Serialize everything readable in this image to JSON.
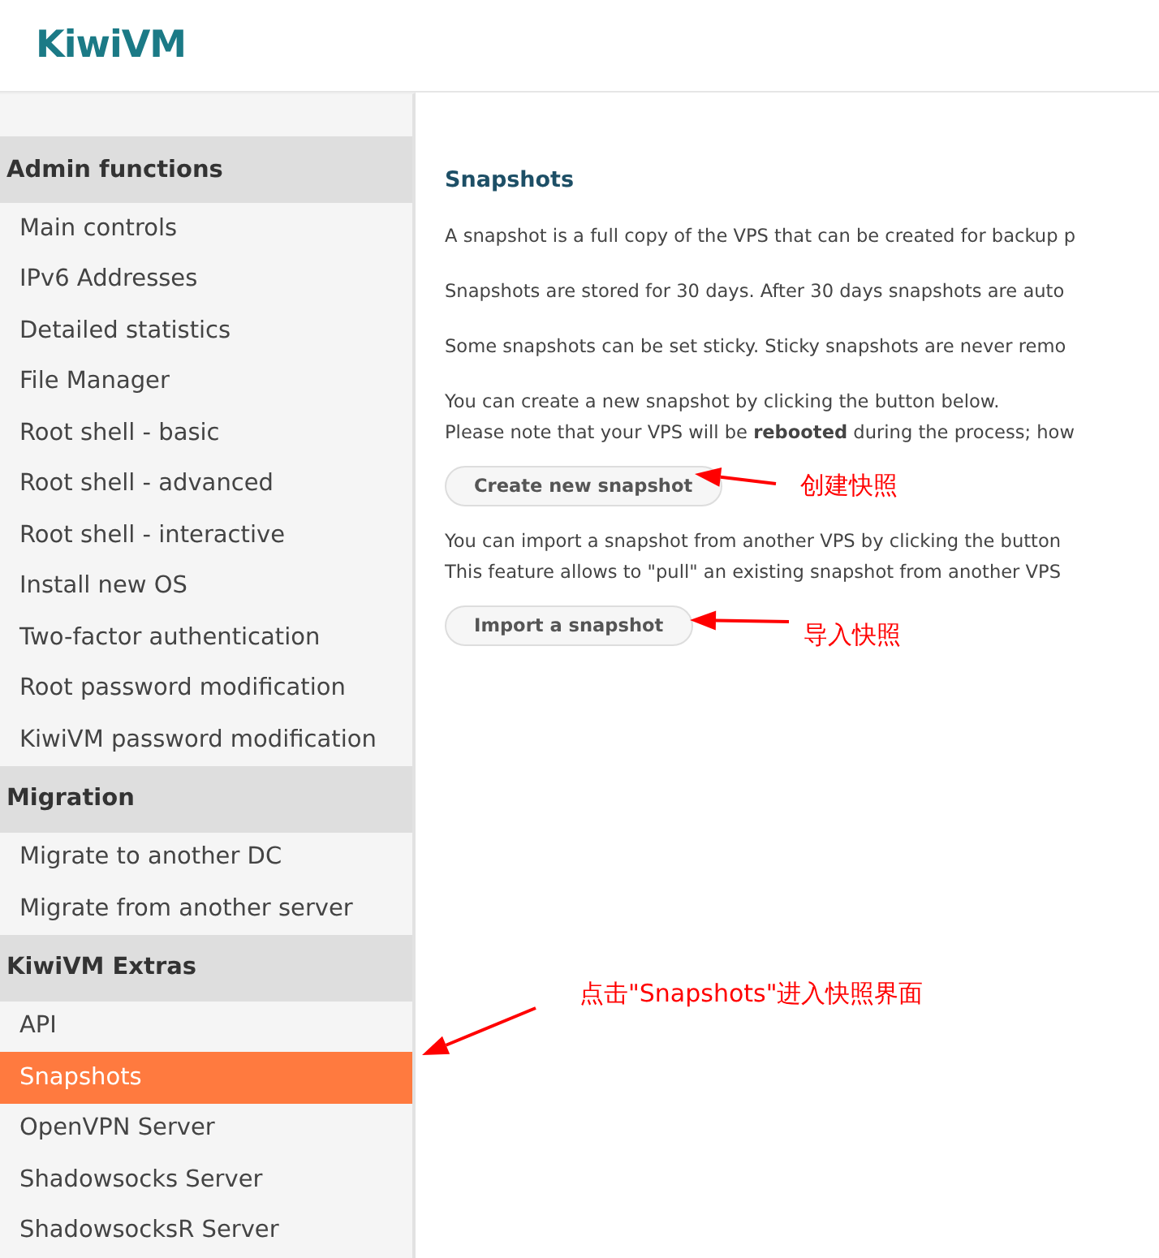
{
  "logo": "KiwiVM",
  "sidebar": {
    "sections": [
      {
        "title": "Admin functions",
        "items": [
          {
            "label": "Main controls",
            "selected": false
          },
          {
            "label": "IPv6 Addresses",
            "selected": false
          },
          {
            "label": "Detailed statistics",
            "selected": false
          },
          {
            "label": "File Manager",
            "selected": false
          },
          {
            "label": "Root shell - basic",
            "selected": false
          },
          {
            "label": "Root shell - advanced",
            "selected": false
          },
          {
            "label": "Root shell - interactive",
            "selected": false
          },
          {
            "label": "Install new OS",
            "selected": false
          },
          {
            "label": "Two-factor authentication",
            "selected": false
          },
          {
            "label": "Root password modification",
            "selected": false
          },
          {
            "label": "KiwiVM password modification",
            "selected": false
          }
        ]
      },
      {
        "title": "Migration",
        "items": [
          {
            "label": "Migrate to another DC",
            "selected": false
          },
          {
            "label": "Migrate from another server",
            "selected": false
          }
        ]
      },
      {
        "title": "KiwiVM Extras",
        "items": [
          {
            "label": "API",
            "selected": false
          },
          {
            "label": "Snapshots",
            "selected": true
          },
          {
            "label": "OpenVPN Server",
            "selected": false
          },
          {
            "label": "Shadowsocks Server",
            "selected": false
          },
          {
            "label": "ShadowsocksR Server",
            "selected": false
          }
        ]
      }
    ]
  },
  "content": {
    "title": "Snapshots",
    "blocks": [
      {
        "kind": "paragraph",
        "lines": [
          "A snapshot is a full copy of the VPS that can be created for backup p"
        ]
      },
      {
        "kind": "paragraph",
        "lines": [
          "Snapshots are stored for 30 days. After 30 days snapshots are auto"
        ]
      },
      {
        "kind": "paragraph",
        "lines": [
          "Some snapshots can be set sticky. Sticky snapshots are never remo"
        ]
      },
      {
        "kind": "paragraph",
        "lines": [
          "You can create a new snapshot by clicking the button below.",
          "Please note that your VPS will be **rebooted** during the process; how"
        ]
      },
      {
        "kind": "button",
        "label": "Create new snapshot"
      },
      {
        "kind": "paragraph",
        "lines": [
          "You can import a snapshot from another VPS by clicking the button",
          "This feature allows to \"pull\" an existing snapshot from another VPS"
        ]
      },
      {
        "kind": "button",
        "label": "Import a snapshot"
      }
    ]
  },
  "annotations": [
    {
      "text": "创建快照"
    },
    {
      "text": "导入快照"
    },
    {
      "text": "点击\"Snapshots\"进入快照界面"
    }
  ]
}
